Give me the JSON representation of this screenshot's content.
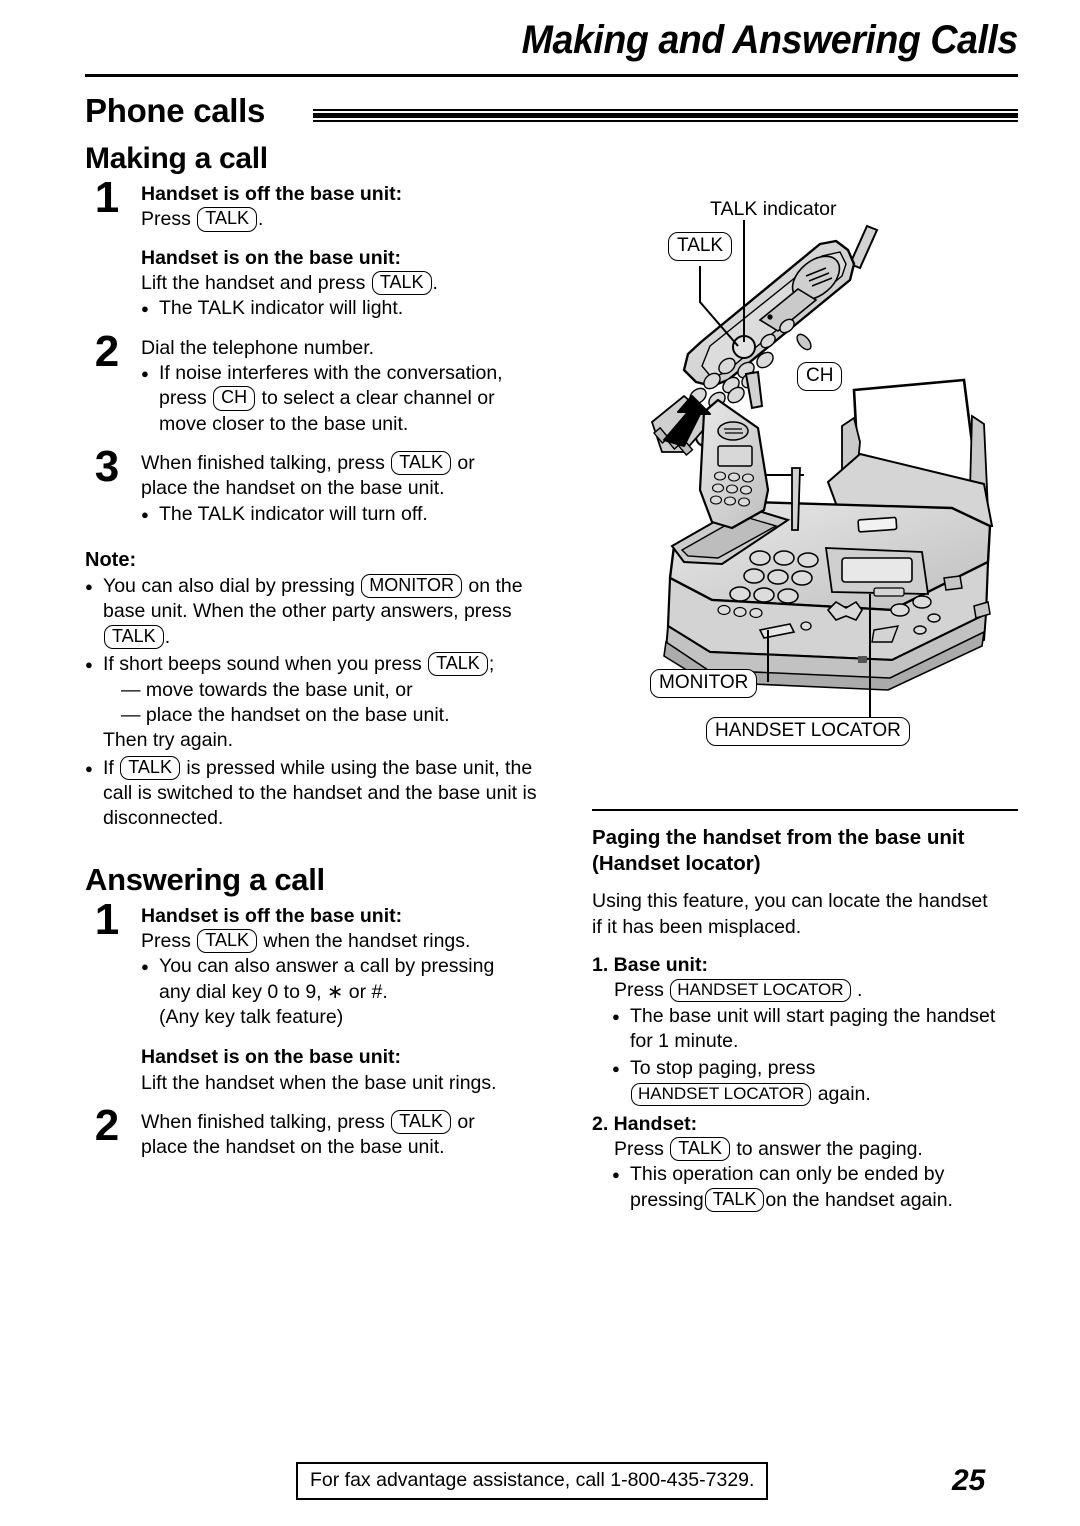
{
  "header": {
    "title": "Making and Answering Calls"
  },
  "band": {
    "title": "Phone calls"
  },
  "making": {
    "heading": "Making a call",
    "step1": {
      "num": "1",
      "line_off_bold": "Handset is off the base unit:",
      "line_off_press": "Press",
      "key_talk": "TALK",
      "period": ".",
      "line_on_bold": "Handset is on the base unit:",
      "line_on_lift": "Lift the handset and press",
      "key_talk2": "TALK",
      "period2": ".",
      "bullet1": "The TALK indicator will light."
    },
    "step2": {
      "num": "2",
      "line1": "Dial the telephone number.",
      "bullet1_a": "If noise interferes with the conversation,",
      "bullet1_b": "press",
      "key_ch": "CH",
      "bullet1_c": "to select a clear channel or",
      "bullet1_d": "move closer to the base unit."
    },
    "step3": {
      "num": "3",
      "line1_a": "When finished talking, press",
      "key_talk": "TALK",
      "line1_b": "or",
      "line2": "place the handset on the base unit.",
      "bullet1": "The TALK indicator will turn off."
    },
    "note": {
      "title": "Note:",
      "b1_a": "You can also dial by pressing",
      "b1_key": "MONITOR",
      "b1_b": "on the",
      "b1_c": "base unit. When the other party answers, press",
      "b1_key2": "TALK",
      "b1_d": ".",
      "b2_a": "If short beeps sound when you press",
      "b2_key": "TALK",
      "b2_b": ";",
      "b2_dash1": "— move towards the base unit, or",
      "b2_dash2": "— place the handset on the base unit.",
      "b2_then": "Then try again.",
      "b3_a": "If",
      "b3_key": "TALK",
      "b3_b": "is pressed while using the base unit, the",
      "b3_c": "call is switched to the handset and the base unit is",
      "b3_d": "disconnected."
    }
  },
  "answering": {
    "heading": "Answering a call",
    "step1": {
      "num": "1",
      "line_off_bold": "Handset is off the base unit:",
      "press": "Press",
      "key_talk": "TALK",
      "when_rings": "when the handset rings.",
      "bullet1_a": "You can also answer a call by pressing",
      "bullet1_b": "any dial key 0 to 9,  ∗  or #.",
      "bullet1_c": "(Any key talk feature)",
      "line_on_bold": "Handset is on the base unit:",
      "line_on_lift": "Lift the handset when the base unit rings."
    },
    "step2": {
      "num": "2",
      "line1_a": "When finished talking, press",
      "key_talk": "TALK",
      "line1_b": "or",
      "line2": "place the handset on the base unit."
    }
  },
  "illustration": {
    "talk_indicator_label": "TALK indicator",
    "talk_callout": "TALK",
    "ch_callout": "CH",
    "monitor_callout": "MONITOR",
    "handset_locator_callout": "HANDSET LOCATOR"
  },
  "paging": {
    "heading_line1": "Paging the handset from the base unit",
    "heading_line2": "(Handset locator)",
    "intro_a": "Using this feature, you can locate the handset",
    "intro_b": "if it has been misplaced.",
    "item1_head": "1. Base unit:",
    "item1_press": "Press",
    "item1_key": "HANDSET LOCATOR",
    "item1_period": ".",
    "item1_b1_a": "The base unit will start paging the handset",
    "item1_b1_b": "for 1 minute.",
    "item1_b2_a": "To stop paging, press",
    "item1_b2_key": "HANDSET LOCATOR",
    "item1_b2_b": "again.",
    "item2_head": "2. Handset:",
    "item2_press": "Press",
    "item2_key": "TALK",
    "item2_after": "to answer the paging.",
    "item2_b1_a": "This operation can only be ended by",
    "item2_b1_b": "pressing",
    "item2_b1_key": "TALK",
    "item2_b1_c": "on the handset again."
  },
  "footer": {
    "notice": "For fax advantage assistance, call 1-800-435-7329.",
    "page_number": "25"
  }
}
